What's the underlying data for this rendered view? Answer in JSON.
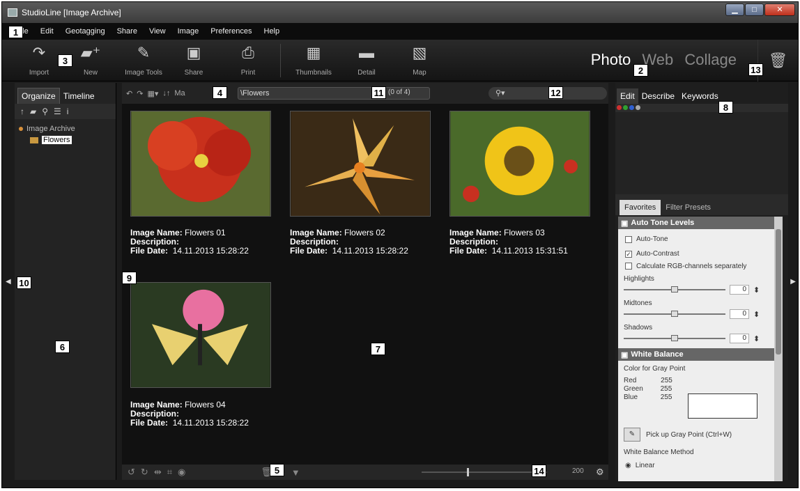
{
  "window": {
    "title": "StudioLine [Image Archive]",
    "min": "▁",
    "max": "□",
    "close": "✕"
  },
  "menu": [
    "File",
    "Edit",
    "Geotagging",
    "Share",
    "View",
    "Image",
    "Preferences",
    "Help"
  ],
  "toolbar": {
    "import": "Import",
    "new": "New",
    "image_tools": "Image Tools",
    "share": "Share",
    "print": "Print",
    "thumbnails": "Thumbnails",
    "detail": "Detail",
    "map": "Map"
  },
  "modes": [
    "Photo",
    "Web",
    "Collage"
  ],
  "left": {
    "tabs": [
      "Organize",
      "Timeline"
    ],
    "root": "Image Archive",
    "folder": "Flowers"
  },
  "center": {
    "sort_label": "Ma",
    "path": "\\Flowers",
    "count": "(0 of 4)",
    "zoom_value": "200"
  },
  "captions": {
    "name_label": "Image Name:",
    "desc_label": "Description:",
    "date_label": "File Date:"
  },
  "images": [
    {
      "name": "Flowers 01",
      "date": "14.11.2013 15:28:22"
    },
    {
      "name": "Flowers 02",
      "date": "14.11.2013 15:28:22"
    },
    {
      "name": "Flowers 03",
      "date": "14.11.2013 15:31:51"
    },
    {
      "name": "Flowers 04",
      "date": "14.11.2013 15:28:22"
    }
  ],
  "right": {
    "tabs": [
      "Edit",
      "Describe",
      "Keywords"
    ],
    "filter_tabs": [
      "Favorites",
      "Filter Presets"
    ],
    "auto_tone": {
      "title": "Auto Tone Levels",
      "opt1": "Auto-Tone",
      "opt2": "Auto-Contrast",
      "opt3": "Calculate RGB-channels separately",
      "auto_contrast_checked": true,
      "highlights": "Highlights",
      "midtones": "Midtones",
      "shadows": "Shadows",
      "h_val": "0",
      "m_val": "0",
      "s_val": "0"
    },
    "white_balance": {
      "title": "White Balance",
      "color_label": "Color for Gray Point",
      "red": "Red",
      "green": "Green",
      "blue": "Blue",
      "r": "255",
      "g": "255",
      "b": "255",
      "pick": "Pick up Gray Point (Ctrl+W)",
      "method": "White Balance Method",
      "linear": "Linear"
    }
  },
  "callouts": [
    "1",
    "2",
    "3",
    "4",
    "5",
    "6",
    "7",
    "8",
    "9",
    "10",
    "11",
    "12",
    "13",
    "14"
  ]
}
